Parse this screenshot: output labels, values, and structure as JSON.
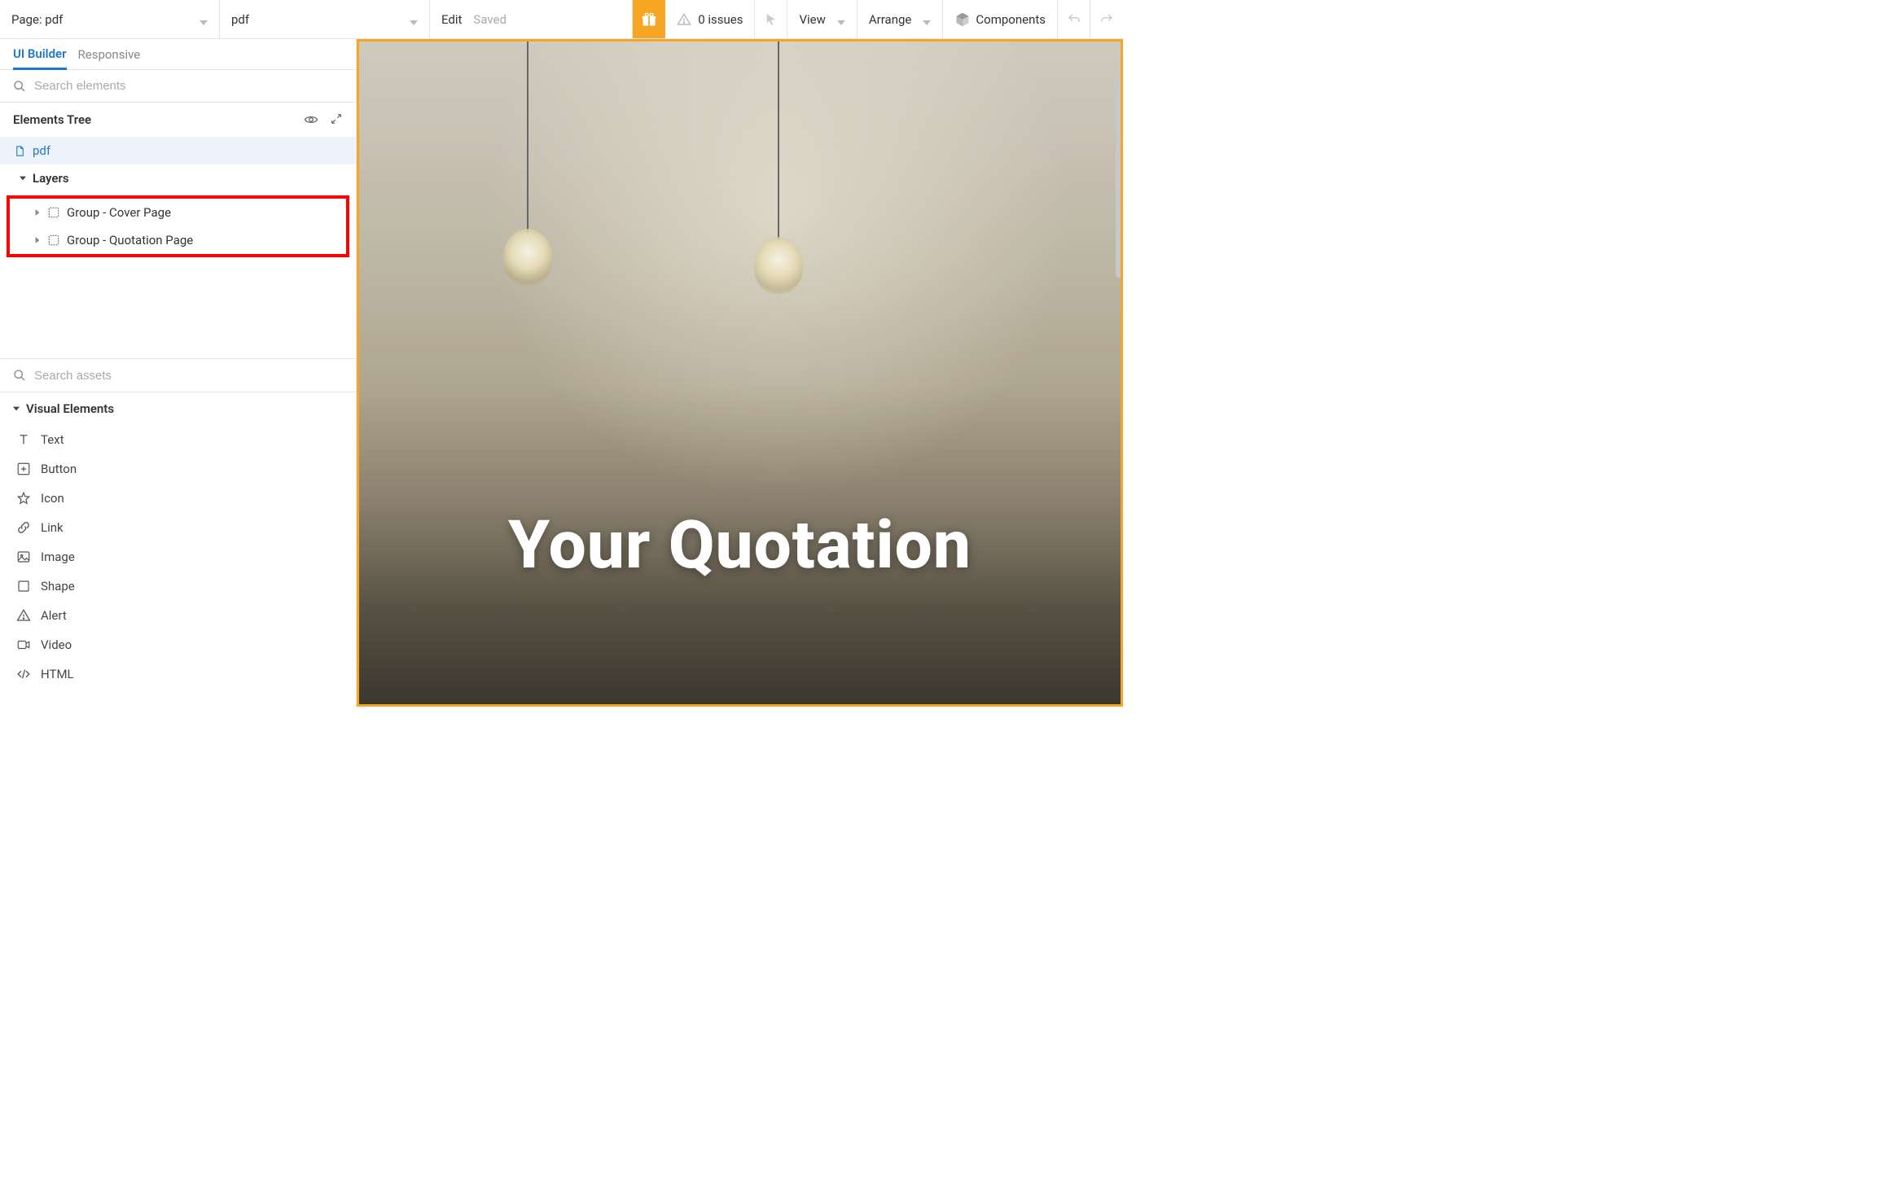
{
  "toolbar": {
    "page_label_prefix": "Page: ",
    "page_name": "pdf",
    "element_name": "pdf",
    "edit_label": "Edit",
    "saved_label": "Saved",
    "issues_count": "0 issues",
    "view_label": "View",
    "arrange_label": "Arrange",
    "components_label": "Components"
  },
  "tabs": {
    "ui_builder": "UI Builder",
    "responsive": "Responsive"
  },
  "search": {
    "elements_placeholder": "Search elements",
    "assets_placeholder": "Search assets"
  },
  "tree": {
    "header": "Elements Tree",
    "root": "pdf",
    "layers_label": "Layers",
    "items": [
      {
        "label": "Group - Cover Page"
      },
      {
        "label": "Group - Quotation Page"
      }
    ]
  },
  "visual_elements": {
    "header": "Visual Elements",
    "items": [
      {
        "label": "Text",
        "icon": "text"
      },
      {
        "label": "Button",
        "icon": "button"
      },
      {
        "label": "Icon",
        "icon": "star"
      },
      {
        "label": "Link",
        "icon": "link"
      },
      {
        "label": "Image",
        "icon": "image"
      },
      {
        "label": "Shape",
        "icon": "shape"
      },
      {
        "label": "Alert",
        "icon": "alert"
      },
      {
        "label": "Video",
        "icon": "video"
      },
      {
        "label": "HTML",
        "icon": "html"
      }
    ]
  },
  "canvas": {
    "title": "Your Quotation"
  },
  "colors": {
    "accent": "#1f78d1",
    "gift": "#f5a623",
    "highlight": "#ff0000"
  }
}
